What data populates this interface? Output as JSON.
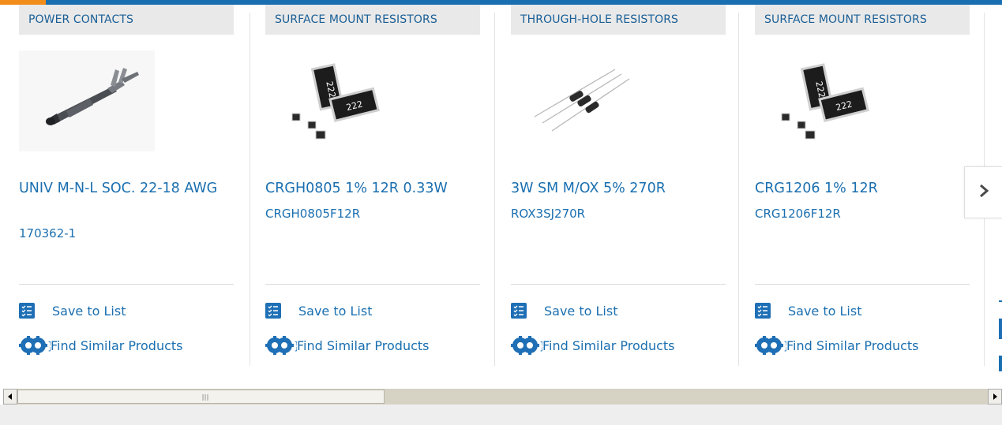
{
  "colors": {
    "accent_orange": "#f28c1b",
    "brand_blue": "#1a6fb0",
    "category_bg": "#e9e9e9"
  },
  "products": [
    {
      "category": "POWER CONTACTS",
      "title": "UNIV M-N-L SOC. 22-18 AWG",
      "part_number": "170362-1",
      "image_icon": "power-contact-image",
      "save_label": "Save to List",
      "similar_label": "Find Similar Products"
    },
    {
      "category": "SURFACE MOUNT RESISTORS",
      "title": "CRGH0805 1% 12R 0.33W",
      "part_number": "CRGH0805F12R",
      "image_icon": "smd-resistor-image",
      "image_marking": "222",
      "save_label": "Save to List",
      "similar_label": "Find Similar Products"
    },
    {
      "category": "THROUGH-HOLE RESISTORS",
      "title": "3W SM M/OX 5% 270R",
      "part_number": "ROX3SJ270R",
      "image_icon": "through-hole-resistor-image",
      "save_label": "Save to List",
      "similar_label": "Find Similar Products"
    },
    {
      "category": "SURFACE MOUNT RESISTORS",
      "title": "CRG1206 1% 12R",
      "part_number": "CRG1206F12R",
      "image_icon": "smd-resistor-image",
      "image_marking": "222",
      "save_label": "Save to List",
      "similar_label": "Find Similar Products"
    }
  ],
  "carousel": {
    "next_icon": "chevron-right-icon"
  },
  "scrollbar": {
    "left_icon": "scroll-left-arrow-icon",
    "right_icon": "scroll-right-arrow-icon",
    "position_fraction": 0
  }
}
